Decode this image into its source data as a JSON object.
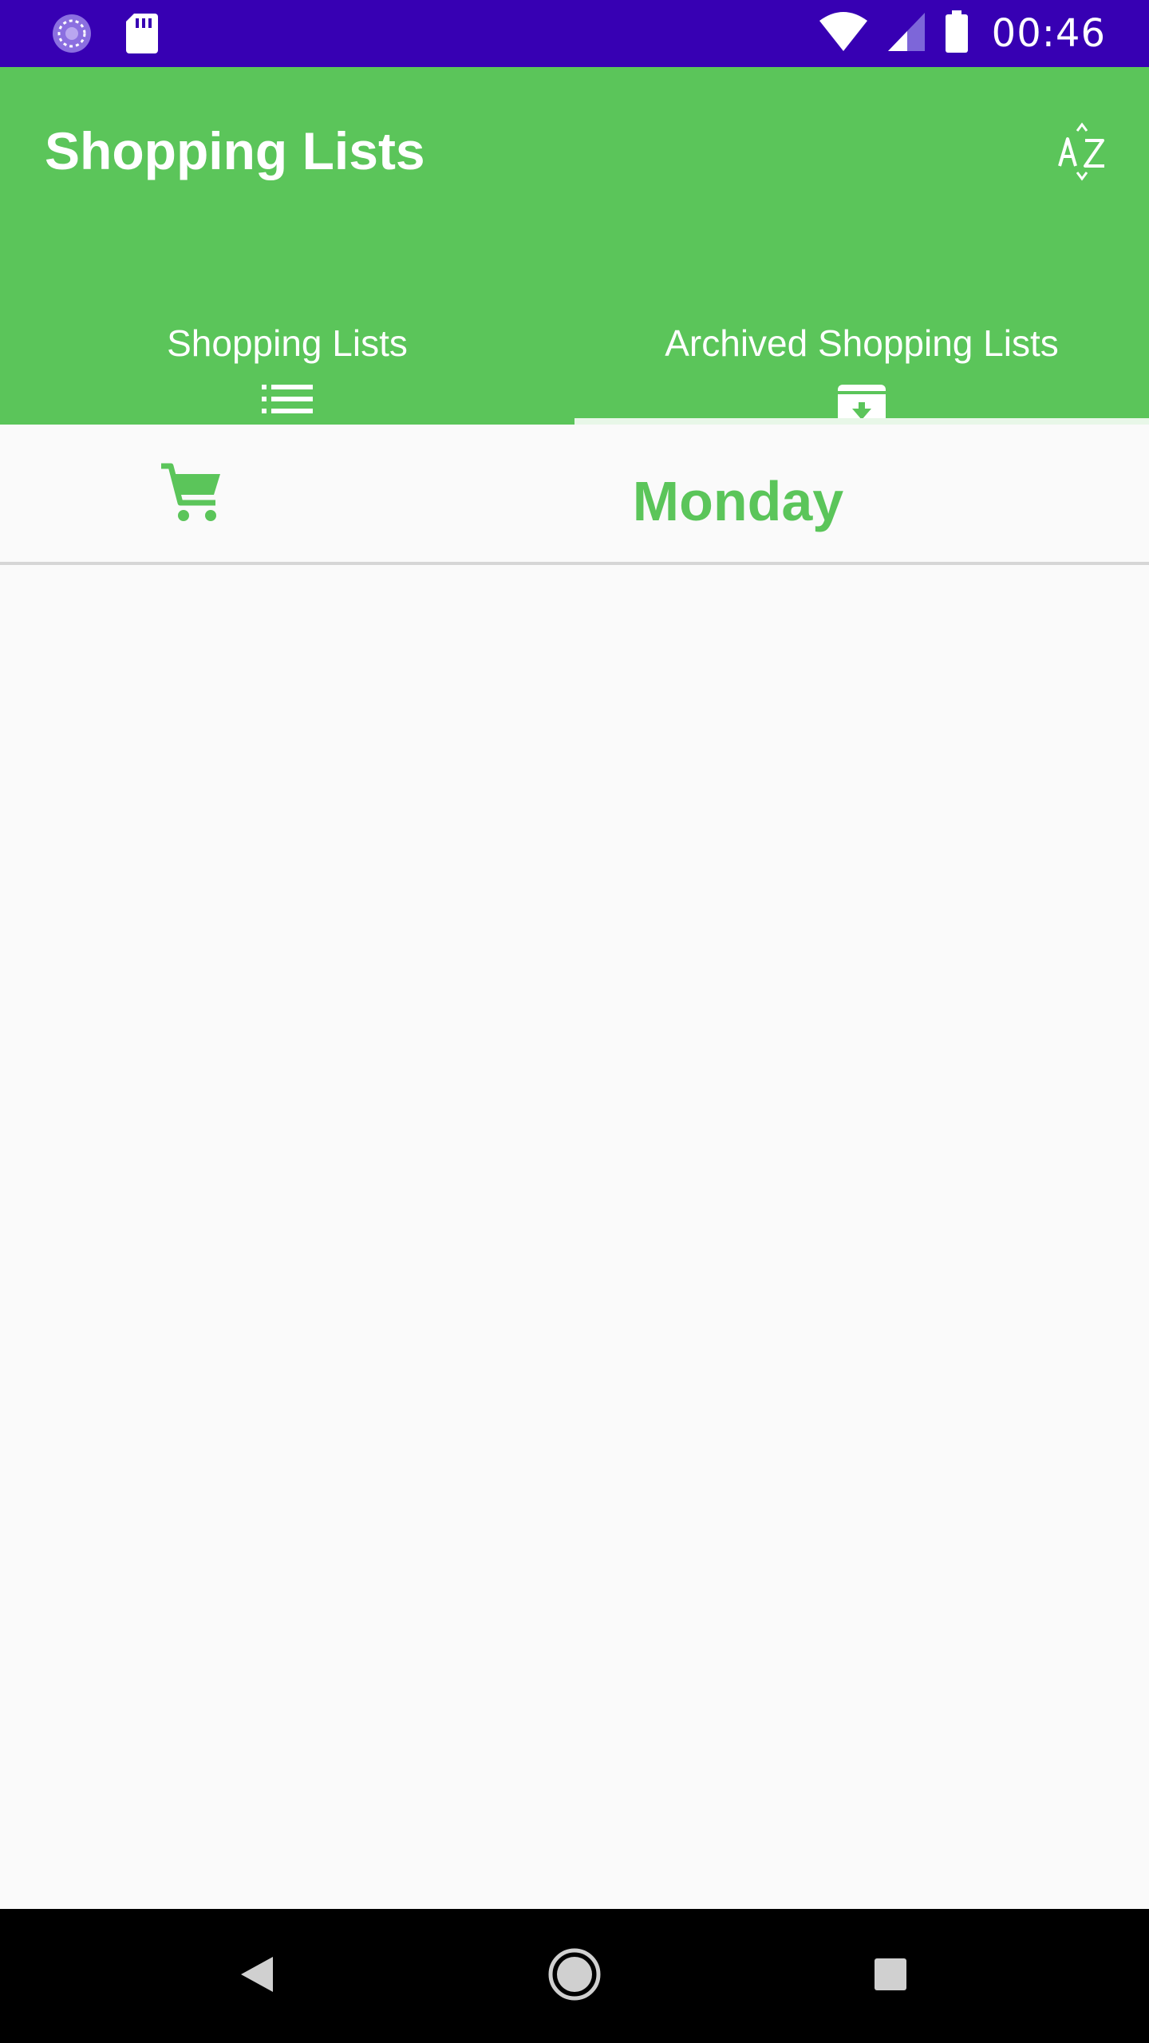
{
  "status_bar": {
    "time": "00:46",
    "icons": [
      "sync-icon",
      "sd-card-icon",
      "wifi-icon",
      "signal-icon",
      "battery-icon"
    ]
  },
  "app_bar": {
    "title": "Shopping Lists",
    "sort_icon": "sort-alphabetical-icon"
  },
  "tabs": [
    {
      "label": "Shopping Lists",
      "icon": "list-icon",
      "selected": false
    },
    {
      "label": "Archived Shopping Lists",
      "icon": "archive-icon",
      "selected": true
    }
  ],
  "list_row": {
    "icon": "shopping-cart-icon",
    "name": "Monday"
  },
  "navigation": {
    "buttons": [
      "back-icon",
      "home-icon",
      "recents-icon"
    ]
  },
  "colors": {
    "status_bar": "#3700b3",
    "primary": "#5bc55a",
    "background": "#fafafa",
    "nav_bar": "#000000"
  }
}
